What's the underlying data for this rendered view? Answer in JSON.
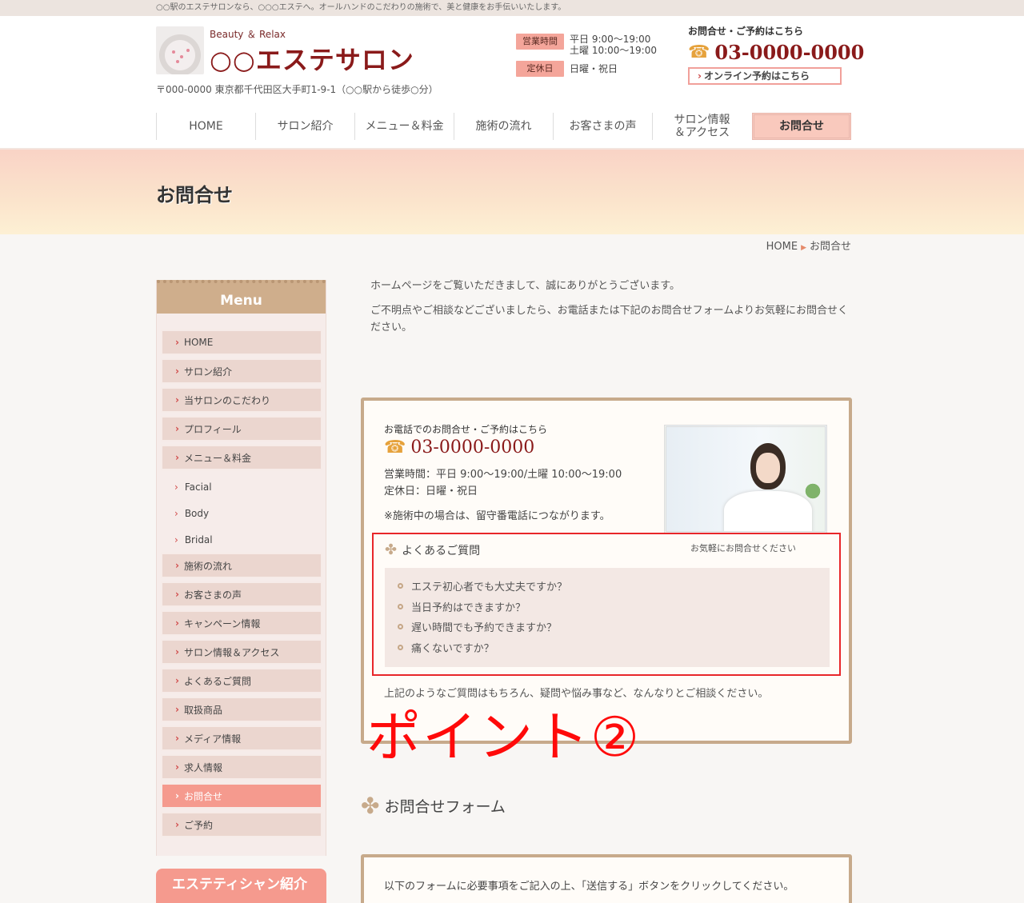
{
  "topbar": {
    "text": "○○駅のエステサロンなら、○○○エステへ。オールハンドのこだわりの施術で、美と健康をお手伝いいたします。"
  },
  "header": {
    "tagline": "Beauty ＆ Relax",
    "title": "○○エステサロン",
    "address": "〒000-0000 東京都千代田区大手町1-9-1（○○駅から徒歩○分）",
    "hours_badge": "営業時間",
    "hours_line1": "平日 9:00〜19:00",
    "hours_line2": "土曜 10:00〜19:00",
    "closed_badge": "定休日",
    "closed_text": "日曜・祝日",
    "contact_title": "お問合せ・ご予約はこちら",
    "phone": "03-0000-0000",
    "online_label": "オンライン予約はこちら"
  },
  "nav": {
    "home": "HOME",
    "salon": "サロン紹介",
    "menu": "メニュー＆料金",
    "flow": "施術の流れ",
    "voice": "お客さまの声",
    "access_line1": "サロン情報",
    "access_line2": "＆アクセス",
    "contact": "お問合せ"
  },
  "banner": {
    "title": "お問合せ"
  },
  "breadcrumb": {
    "home": "HOME",
    "current": "お問合せ"
  },
  "sidebar": {
    "heading": "Menu",
    "items": [
      "HOME",
      "サロン紹介",
      "当サロンのこだわり",
      "プロフィール",
      "メニュー＆料金"
    ],
    "sub_items": [
      "Facial",
      "Body",
      "Bridal"
    ],
    "items2": [
      "施術の流れ",
      "お客さまの声",
      "キャンペーン情報",
      "サロン情報＆アクセス",
      "よくあるご質問",
      "取扱商品",
      "メディア情報",
      "求人情報",
      "お問合せ",
      "ご予約"
    ],
    "esthe_heading": "エステティシャン紹介"
  },
  "intro": {
    "p1": "ホームページをご覧いただきまして、誠にありがとうございます。",
    "p2": "ご不明点やご相談などございましたら、お電話または下記のお問合せフォームよりお気軽にお問合せください。"
  },
  "card": {
    "label": "お電話でのお問合せ・ご予約はこちら",
    "phone": "03-0000-0000",
    "hours": "営業時間：平日 9:00〜19:00/土曜 10:00〜19:00",
    "closed": "定休日：日曜・祝日",
    "note": "※施術中の場合は、留守番電話につながります。",
    "faq_title": "よくあるご質問",
    "faq_caption": "お気軽にお問合せください",
    "faq": [
      "エステ初心者でも大丈夫ですか？",
      "当日予約はできますか？",
      "遅い時間でも予約できますか？",
      "痛くないですか？"
    ],
    "after": "上記のようなご質問はもちろん、疑問や悩み事など、なんなりとご相談ください。",
    "point": "ポイント②"
  },
  "form": {
    "heading": "お問合せフォーム",
    "text": "以下のフォームに必要事項をご記入の上、「送信する」ボタンをクリックしてください。"
  },
  "colors": {
    "accent": "#8a1a1a",
    "pink": "#f59a8e",
    "beige": "#c7aa8b",
    "annotation": "#ff0a0a"
  }
}
